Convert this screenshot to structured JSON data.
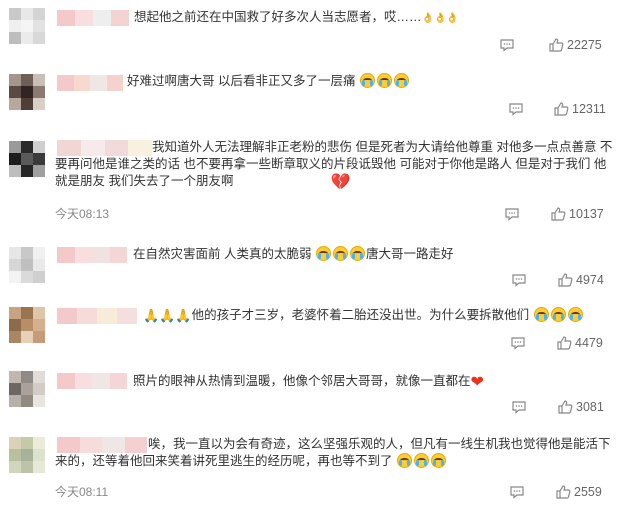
{
  "comments": [
    {
      "text": "想起他之前还在中国救了好多次人当志愿者，哎……",
      "suffix": "👌👌👌",
      "likes": "22275",
      "time": "",
      "avatar": [
        "#c9c9c9",
        "#e8e8e8",
        "#d4d4d4",
        "#efefef",
        "#f5f5f5",
        "#e2e2e2",
        "#bdbdbd",
        "#ebebeb",
        "#d8d8d8"
      ],
      "uname": [
        "#f3c9c9",
        "#f8dede",
        "#eeeeee",
        "#f4d3d3"
      ]
    },
    {
      "text": "好难过啊唐大哥 以后看非正又多了一层痛",
      "likes": "12311",
      "time": "",
      "avatar": [
        "#a4968c",
        "#6e5e55",
        "#c8bfb7",
        "#5b4a42",
        "#2f2624",
        "#8a7a6f",
        "#b6a89c",
        "#4e3f38",
        "#d8cfc6"
      ],
      "uname": [
        "#f3c9c9",
        "#f7d9d0",
        "#f1e6e6",
        "#f5d2cc"
      ]
    },
    {
      "text": "我知道外人无法理解非正老粉的悲伤 但是死者为大请给他尊重 对他多一点点善意 不要再问他是谁之类的话 也不要再拿一些断章取义的片段诋毁他 可能对于你他是路人 但是对于我们 他就是朋友 我们失去了一个朋友啊",
      "likes": "10137",
      "time": "今天08:13",
      "avatar": [
        "#9a9a9a",
        "#2a2a2a",
        "#cfcfcf",
        "#1d1d1d",
        "#5a5a5a",
        "#3a3a3a",
        "#bdbdbd",
        "#262626",
        "#9f9f9f"
      ],
      "uname": [
        "#f1d6d6",
        "#f7eaea",
        "#f0dada",
        "#f9f1e0"
      ]
    },
    {
      "text": "在自然灾害面前 人类真的太脆弱",
      "text2": "唐大哥一路走好",
      "likes": "4974",
      "time": "",
      "avatar": [
        "#e6e6e6",
        "#c8c8c8",
        "#f0f0f0",
        "#d6d6d6",
        "#bfbfbf",
        "#e9e9e9",
        "#f3f3f3",
        "#dadada",
        "#cfcfcf"
      ],
      "uname": [
        "#f3c9c9",
        "#f8dede",
        "#f1e1e1",
        "#f5d6d6"
      ]
    },
    {
      "text": "他的孩子才三岁，老婆怀着二胎还没出世。为什么要拆散他们",
      "likes": "4479",
      "time": "",
      "avatar": [
        "#c8a382",
        "#9a7450",
        "#e0c6a8",
        "#8c6a4c",
        "#b78e66",
        "#d5b08c",
        "#a98765",
        "#e5d0b8",
        "#c69c78"
      ],
      "uname": [
        "#f3c9c9",
        "#f7dada",
        "#f8ecd8",
        "#f4dede"
      ]
    },
    {
      "text": "照片的眼神从热情到温暖，他像个邻居大哥哥，就像一直都在",
      "likes": "3081",
      "time": "",
      "avatar": [
        "#c0b8b0",
        "#8f8a85",
        "#e1dcd7",
        "#6e6862",
        "#a9a29b",
        "#d3ccc4",
        "#b7b0a8",
        "#928a82",
        "#e8e4df"
      ],
      "uname": [
        "#f3c9c9",
        "#f8dede",
        "#f1e6e6",
        "#f4d6d6"
      ]
    },
    {
      "text": "唉，我一直以为会有奇迹，这么坚强乐观的人，但凡有一线生机我也觉得他是能活下来的，还等着他回来笑着讲死里逃生的经历呢，再也等不到了",
      "likes": "2559",
      "time": "今天08:11",
      "avatar": [
        "#d9d2b8",
        "#c4c9a8",
        "#ecead8",
        "#b8c0a0",
        "#a8b298",
        "#dde2cc",
        "#cfd6bc",
        "#bcc4a8",
        "#e6e8d8"
      ],
      "uname": [
        "#f3c9c9",
        "#f7dcdc",
        "#f1e6e6",
        "#f4d0d0"
      ]
    }
  ]
}
